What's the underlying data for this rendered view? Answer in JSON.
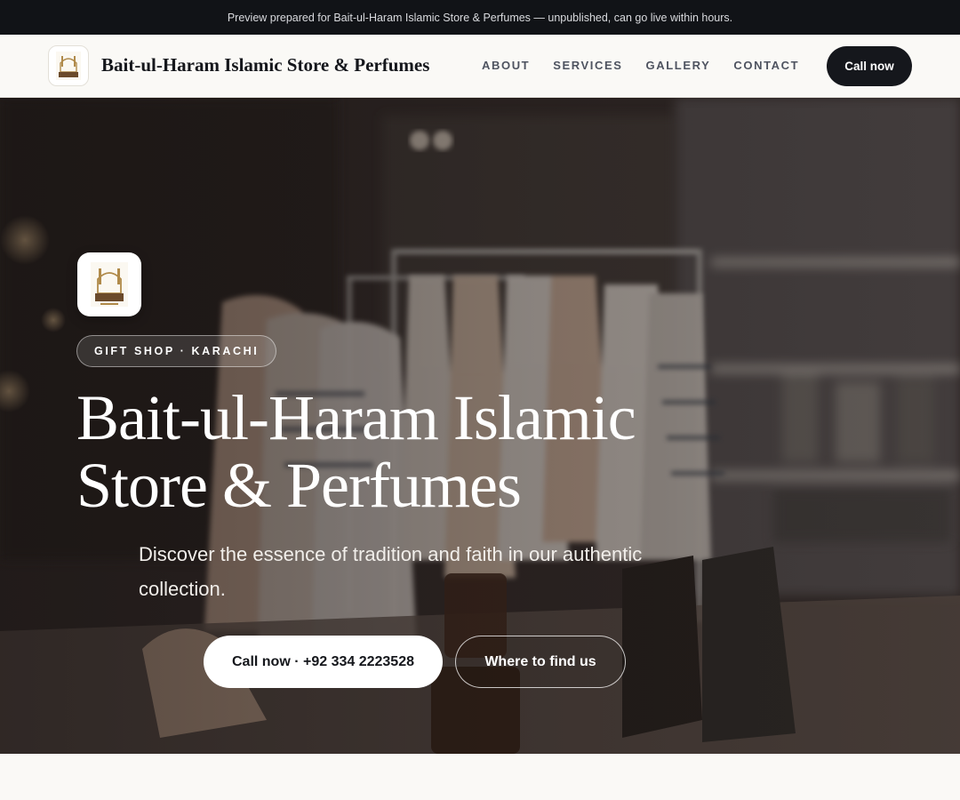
{
  "preview_banner": {
    "text": "Preview prepared for Bait-ul-Haram Islamic Store & Perfumes — unpublished, can go live within hours."
  },
  "header": {
    "brand_name": "Bait-ul-Haram Islamic Store & Perfumes",
    "logo_icon": "store-logo-icon",
    "nav": [
      {
        "label": "ABOUT"
      },
      {
        "label": "SERVICES"
      },
      {
        "label": "GALLERY"
      },
      {
        "label": "CONTACT"
      }
    ],
    "cta_label": "Call now"
  },
  "hero": {
    "logo_icon": "store-logo-icon",
    "tag": "GIFT SHOP · KARACHI",
    "title": "Bait-ul-Haram Islamic Store & Perfumes",
    "subtitle": "Discover the essence of tradition and faith in our authentic collection.",
    "primary_button": "Call now · +92 334 2223528",
    "secondary_button": "Where to find us",
    "background_image": "boutique-interior-photo"
  },
  "colors": {
    "dark": "#15171c",
    "banner_bg": "#111317",
    "page_bg": "#faf9f6",
    "nav_text": "#4e5360",
    "logo_gold": "#b08a4a",
    "logo_brown": "#6b4a2b"
  }
}
